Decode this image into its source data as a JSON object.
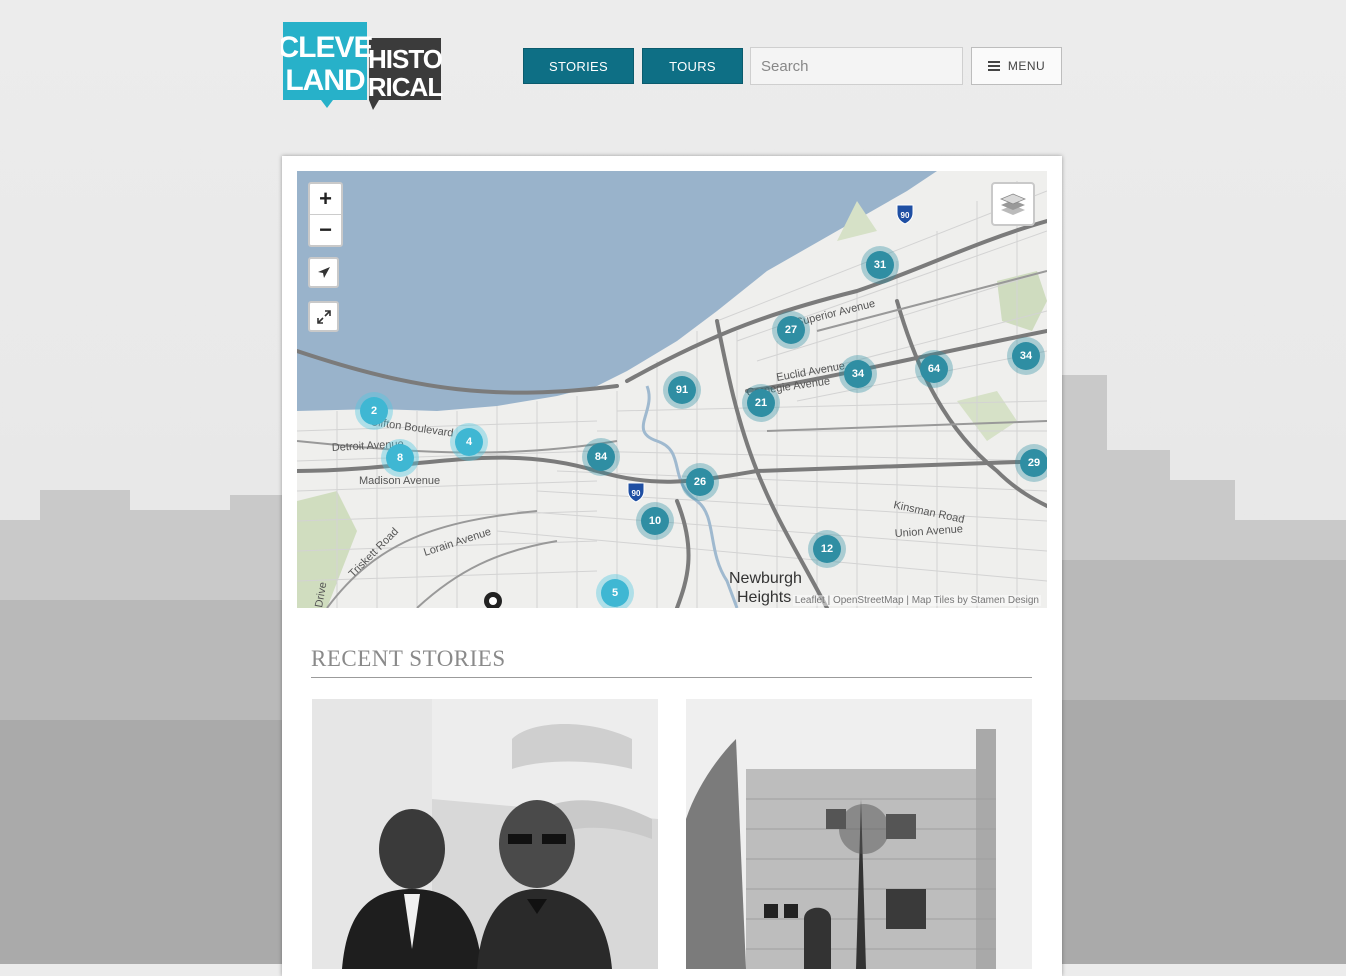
{
  "brand": {
    "logo_line1": "CLEVE",
    "logo_line2": "LAND",
    "logo_line3": "HISTO",
    "logo_line4": "RICAL",
    "colors": {
      "teal": "#27b1c9",
      "dark": "#3b3b3b",
      "button": "#0e6f85"
    }
  },
  "nav": {
    "stories_label": "STORIES",
    "tours_label": "TOURS",
    "search_placeholder": "Search",
    "menu_label": "MENU",
    "menu_icon": "hamburger-icon"
  },
  "map": {
    "zoom_in": "+",
    "zoom_out": "−",
    "locate_icon": "location-arrow-icon",
    "fullscreen_icon": "expand-icon",
    "layers_icon": "layers-icon",
    "attribution": "Leaflet | OpenStreetMap | Map Tiles by Stamen Design",
    "labels": {
      "superior": "Superior Avenue",
      "euclid": "Euclid Avenue",
      "carnegie": "Carnegie Avenue",
      "detroit": "Detroit Avenue",
      "clifton": "Clifton Boulevard",
      "madison": "Madison Avenue",
      "lorain": "Lorain Avenue",
      "triskett": "Triskett Road",
      "kinsman": "Kinsman Road",
      "union": "Union Avenue",
      "newburgh1": "Newburgh",
      "newburgh2": "Heights",
      "drive": "Drive",
      "i90": "90"
    },
    "clusters": [
      "31",
      "27",
      "34",
      "64",
      "34",
      "91",
      "21",
      "2",
      "4",
      "8",
      "84",
      "26",
      "29",
      "10",
      "12",
      "5"
    ]
  },
  "recent": {
    "title": "RECENT STORIES",
    "stories": [
      {
        "image": "photo-two-men"
      },
      {
        "image": "photo-stone-building"
      }
    ]
  }
}
